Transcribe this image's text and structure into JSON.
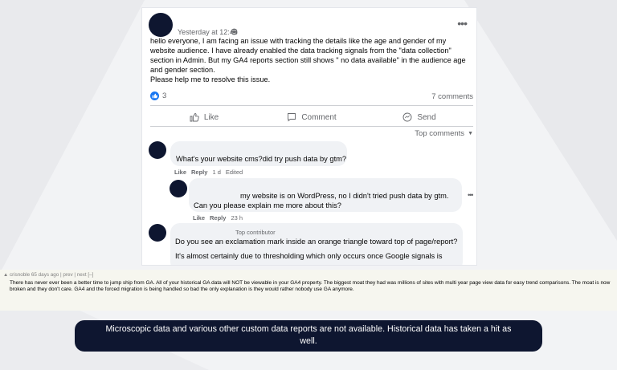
{
  "post": {
    "timestamp": "Yesterday at 12:46",
    "body_lines": [
      "hello everyone, I am facing an issue with tracking the details like the age and gender of my website audience. I have already enabled the data tracking signals from the \"data collection\" section in Admin. But my GA4 reports section still shows \" no data available\" in the audience age and gender section.",
      "Please help me to resolve this issue."
    ],
    "reaction_count": "3",
    "comment_count": "7 comments",
    "actions": {
      "like": "Like",
      "comment": "Comment",
      "send": "Send"
    },
    "sort_label": "Top comments"
  },
  "comments": [
    {
      "text": "What's your website cms?did try push data by gtm?",
      "like": "Like",
      "reply": "Reply",
      "time": "1 d",
      "edited": "Edited"
    },
    {
      "text_line1": "my website is on WordPress, no I didn't tried push data by gtm.",
      "text_line2": "Can you please explain me more about this?",
      "like": "Like",
      "reply": "Reply",
      "time": "23 h"
    },
    {
      "badge": "Top contributor",
      "text_line1": "Do you see an exclamation mark inside an orange triangle toward top of page/report?",
      "text_line2": "It's almost certainly due to thresholding which only occurs once Google signals is"
    }
  ],
  "hn": {
    "meta": "▲ crisnoble 65 days ago | prev | next [–]",
    "text": "There has never ever been a better time to jump ship from GA. All of your historical GA data will NOT be viewable in your GA4 property. The biggest moat they had was millions of sites with multi year page view data for easy trend comparisons. The moat is now broken and they don't care. GA4 and the forced migration is being handled so bad the only explanation is they would rather nobody use GA anymore."
  },
  "caption": "Microscopic data and various other custom data reports are not available. Historical data has taken a hit as well.",
  "colors": {
    "facebook_blue": "#1877f2",
    "caption_bg": "#0e1630",
    "hn_bg": "#f6f6ef",
    "bubble_bg": "#f0f2f5"
  },
  "icons": [
    "globe-icon",
    "more-icon",
    "like-badge-icon",
    "like-icon",
    "comment-icon",
    "send-icon"
  ]
}
